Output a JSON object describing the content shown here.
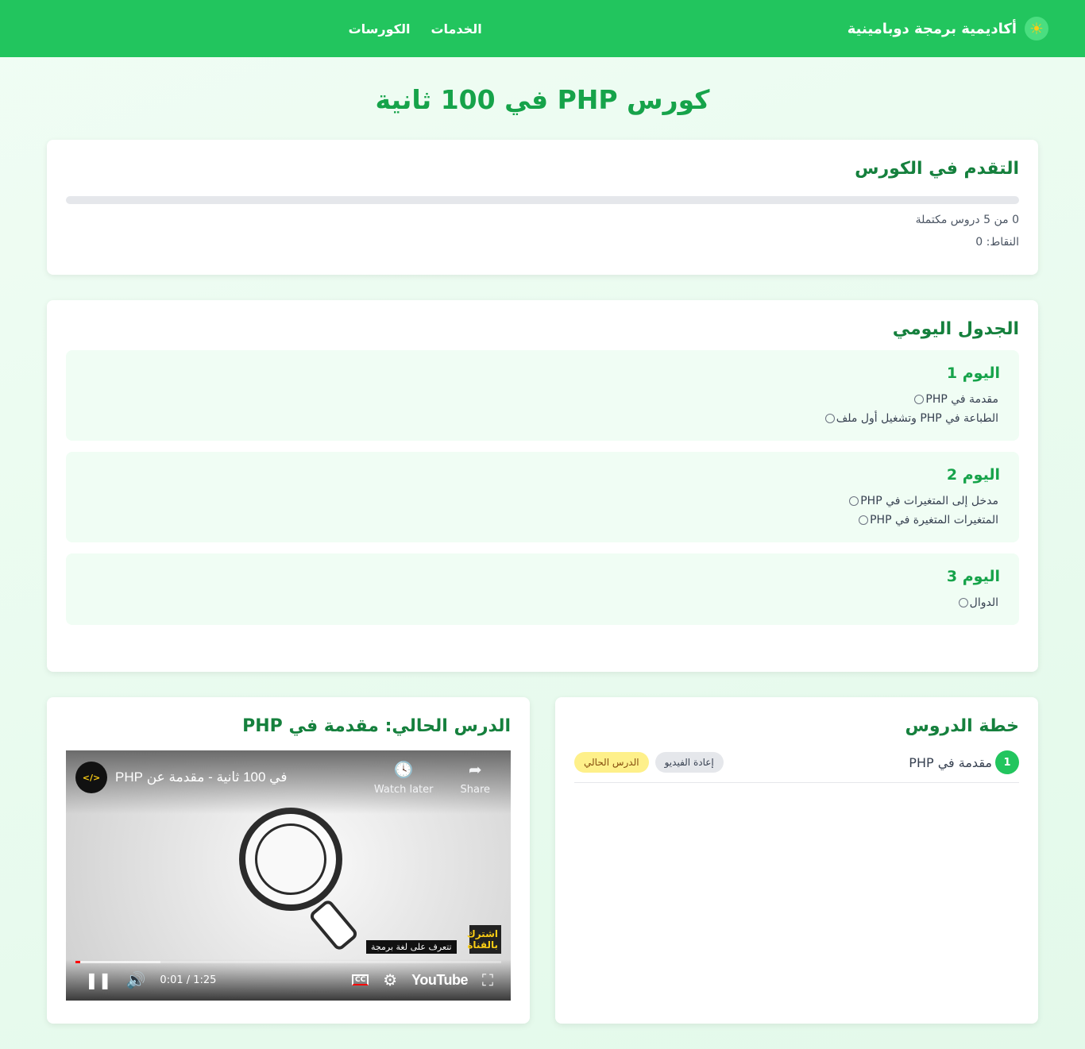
{
  "navbar": {
    "brand": "أكاديمية برمجة دوبامينية",
    "logo_glyph": "☀",
    "links": [
      "الخدمات",
      "الكورسات"
    ]
  },
  "page": {
    "title": "كورس PHP في 100 ثانية"
  },
  "progress": {
    "heading": "التقدم في الكورس",
    "fraction": 0,
    "completed_text": "0 من 5 دروس مكتملة",
    "points_text": "النقاط: 0"
  },
  "schedule": {
    "heading": "الجدول اليومي",
    "days": [
      {
        "title": "اليوم 1",
        "lessons": [
          "مقدمة في PHP",
          "الطباعة في PHP وتشغيل أول ملف"
        ]
      },
      {
        "title": "اليوم 2",
        "lessons": [
          "مدخل إلى المتغيرات في PHP",
          "المتغيرات المتغيرة في PHP"
        ]
      },
      {
        "title": "اليوم 3",
        "lessons": [
          "الدوال"
        ]
      }
    ]
  },
  "plan": {
    "heading": "خطة الدروس",
    "items": [
      {
        "number": "1",
        "title": "مقدمة في PHP",
        "replay_label": "إعادة الفيديو",
        "current_label": "الدرس الحالي"
      }
    ]
  },
  "current": {
    "heading": "الدرس الحالي: مقدمة في PHP",
    "video": {
      "title": "في 100 ثانية - مقدمة عن PHP",
      "watch_later": "Watch later",
      "share": "Share",
      "subscribe": "اشترك بالقناة",
      "caption": "تتعرف على لغة برمجة",
      "time": "0:01 / 1:25",
      "played_fraction": 0.012,
      "buffered_fraction": 0.2,
      "youtube_label": "YouTube",
      "cc_label": "CC"
    }
  },
  "colors": {
    "primary": "#22c55e",
    "heading": "#15803d",
    "accent": "#16a34a"
  }
}
